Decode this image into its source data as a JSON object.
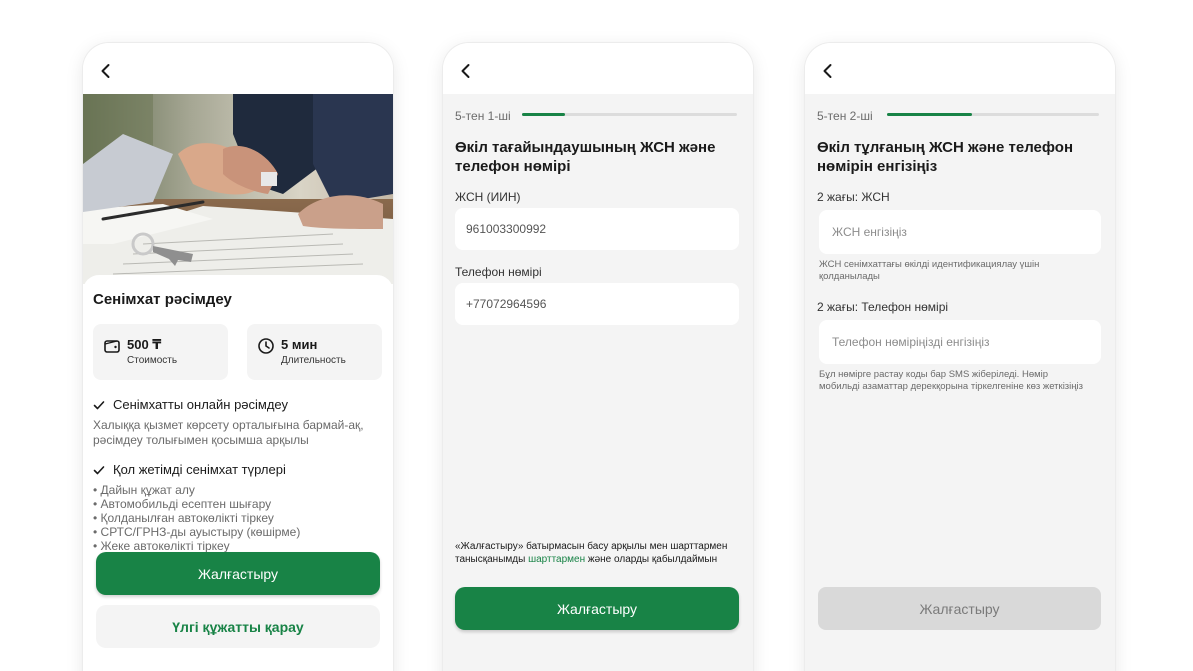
{
  "screen1": {
    "title": "Сенімхат рәсімдеу",
    "cost": {
      "value": "500 ₸",
      "label": "Стоимость",
      "icon": "wallet-icon"
    },
    "duration": {
      "value": "5 мин",
      "label": "Длительность",
      "icon": "clock-icon"
    },
    "feature1": {
      "title": "Сенімхатты онлайн рәсімдеу",
      "description": "Халыққа қызмет көрсету орталығына бармай-ақ, рәсімдеу толығымен қосымша арқылы"
    },
    "feature2": {
      "title": "Қол жетімді сенімхат түрлері",
      "items": [
        "• Дайын құжат алу",
        "• Автомобильді есептен шығару",
        "• Қолданылған автокөлікті тіркеу",
        "• СРТС/ГРНЗ-ды ауыстыру (көшірме)",
        "• Жеке автокөлікті тіркеу"
      ]
    },
    "continue_label": "Жалғастыру",
    "sample_label": "Үлгі құжатты қарау"
  },
  "screen2": {
    "step_label": "5-тен 1-ші",
    "progress": 0.2,
    "title": "Өкіл тағайындаушының ЖСН және телефон нөмірі",
    "iin_label": "ЖСН (ИИН)",
    "iin_value": "961003300992",
    "phone_label": "Телефон нөмірі",
    "phone_value": "+77072964596",
    "terms_before": "«Жалғастыру» батырмасын басу арқылы мен шарттармен танысқанымды ",
    "terms_link": "шарттармен",
    "terms_after": " және оларды қабылдаймын",
    "continue_label": "Жалғастыру"
  },
  "screen3": {
    "step_label": "5-тен 2-ші",
    "progress": 0.4,
    "title": "Өкіл тұлғаның ЖСН және телефон нөмірін енгізіңіз",
    "iin_label": "2 жағы: ЖСН",
    "iin_placeholder": "ЖСН енгізіңіз",
    "iin_hint": "ЖСН сенімхаттағы өкілді идентификациялау үшін қолданылады",
    "phone_label": "2 жағы: Телефон нөмірі",
    "phone_placeholder": "Телефон нөміріңізді енгізіңіз",
    "phone_hint": "Бұл нөмірге растау коды бар SMS жіберіледі. Нөмір мобильді азаматтар дерекқорына тіркелгеніне көз жеткізіңіз",
    "continue_label": "Жалғастыру"
  },
  "colors": {
    "accent": "#188346",
    "disabled_bg": "#d9d9d9",
    "field_bg": "#f4f4f4"
  }
}
